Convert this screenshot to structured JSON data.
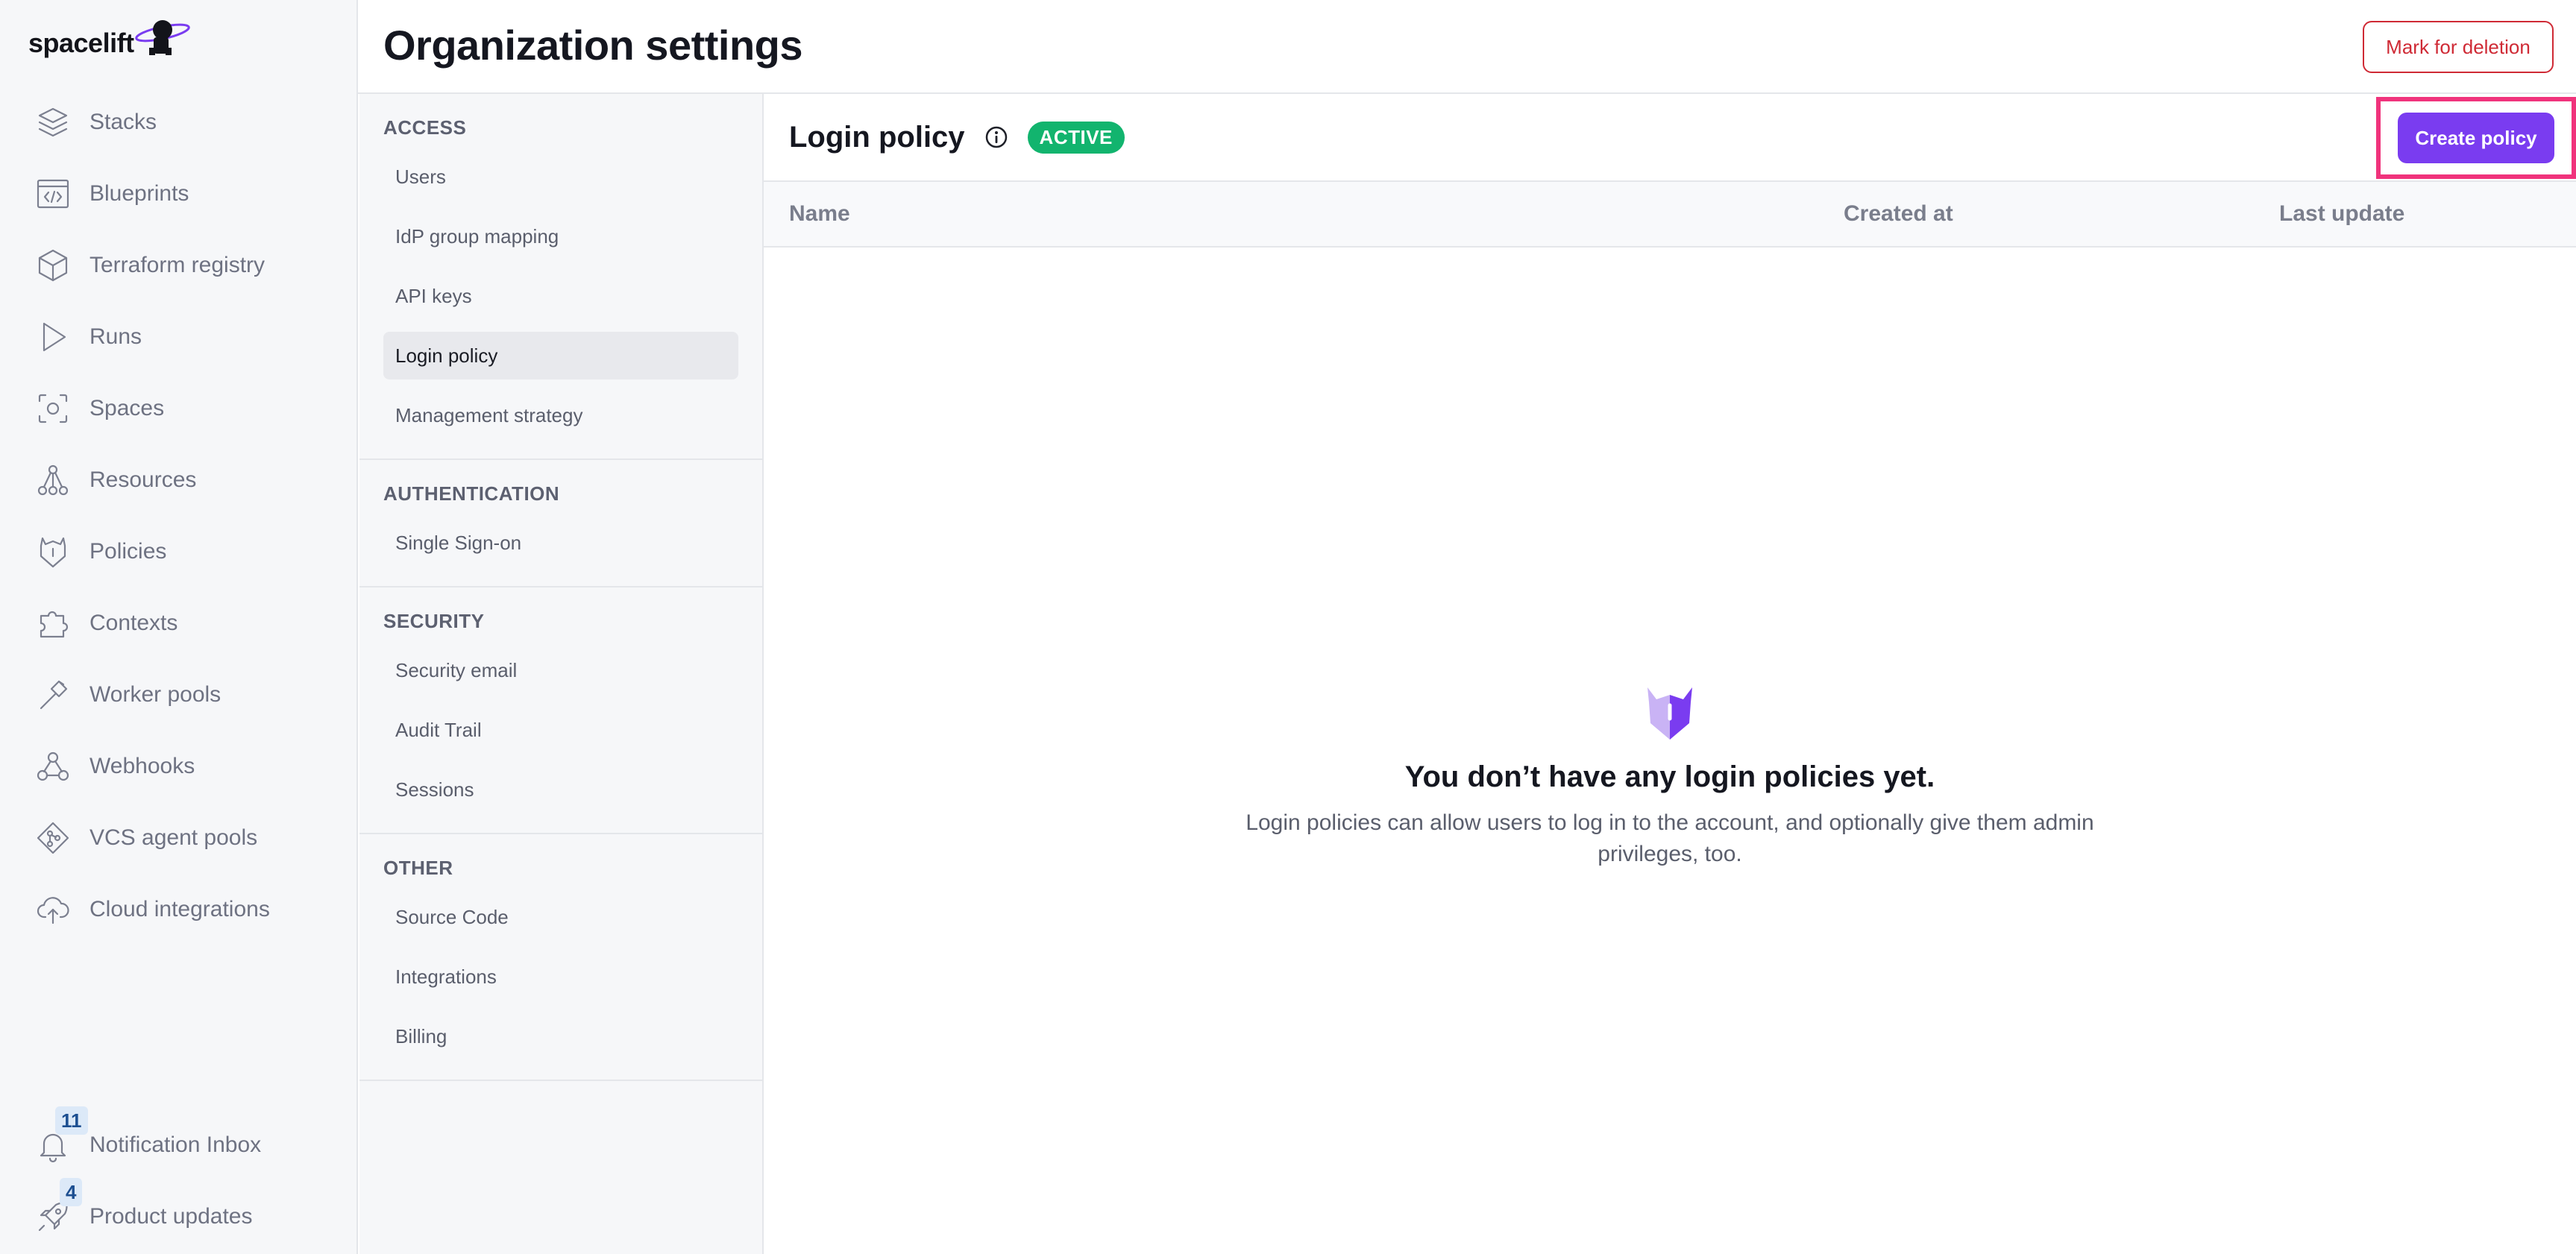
{
  "brand": {
    "name": "spacelift"
  },
  "nav": {
    "items": [
      {
        "label": "Stacks",
        "icon": "layers-icon"
      },
      {
        "label": "Blueprints",
        "icon": "code-window-icon"
      },
      {
        "label": "Terraform registry",
        "icon": "cube-icon"
      },
      {
        "label": "Runs",
        "icon": "play-icon"
      },
      {
        "label": "Spaces",
        "icon": "focus-circle-icon"
      },
      {
        "label": "Resources",
        "icon": "hierarchy-icon"
      },
      {
        "label": "Policies",
        "icon": "shield-horns-icon"
      },
      {
        "label": "Contexts",
        "icon": "puzzle-icon"
      },
      {
        "label": "Worker pools",
        "icon": "hammer-icon"
      },
      {
        "label": "Webhooks",
        "icon": "webhook-icon"
      },
      {
        "label": "VCS agent pools",
        "icon": "git-diamond-icon"
      },
      {
        "label": "Cloud integrations",
        "icon": "cloud-upload-icon"
      }
    ],
    "notification_inbox": {
      "label": "Notification Inbox",
      "count": "11"
    },
    "product_updates": {
      "label": "Product updates",
      "count": "4"
    }
  },
  "header": {
    "title": "Organization settings",
    "mark_for_deletion": "Mark for deletion"
  },
  "settings_nav": {
    "sections": [
      {
        "title": "ACCESS",
        "items": [
          "Users",
          "IdP group mapping",
          "API keys",
          "Login policy",
          "Management strategy"
        ]
      },
      {
        "title": "AUTHENTICATION",
        "items": [
          "Single Sign-on"
        ]
      },
      {
        "title": "SECURITY",
        "items": [
          "Security email",
          "Audit Trail",
          "Sessions"
        ]
      },
      {
        "title": "OTHER",
        "items": [
          "Source Code",
          "Integrations",
          "Billing"
        ]
      }
    ],
    "active_item": "Login policy"
  },
  "main": {
    "title": "Login policy",
    "status": "ACTIVE",
    "create_button": "Create policy",
    "columns": [
      "Name",
      "Created at",
      "Last update"
    ],
    "empty_title": "You don’t have any login policies yet.",
    "empty_description": "Login policies can allow users to log in to the account, and optionally give them admin privileges, too."
  },
  "colors": {
    "accent": "#7a3cf0",
    "status_active": "#12b46e",
    "danger": "#cf2a35",
    "highlight": "#f0337c"
  }
}
